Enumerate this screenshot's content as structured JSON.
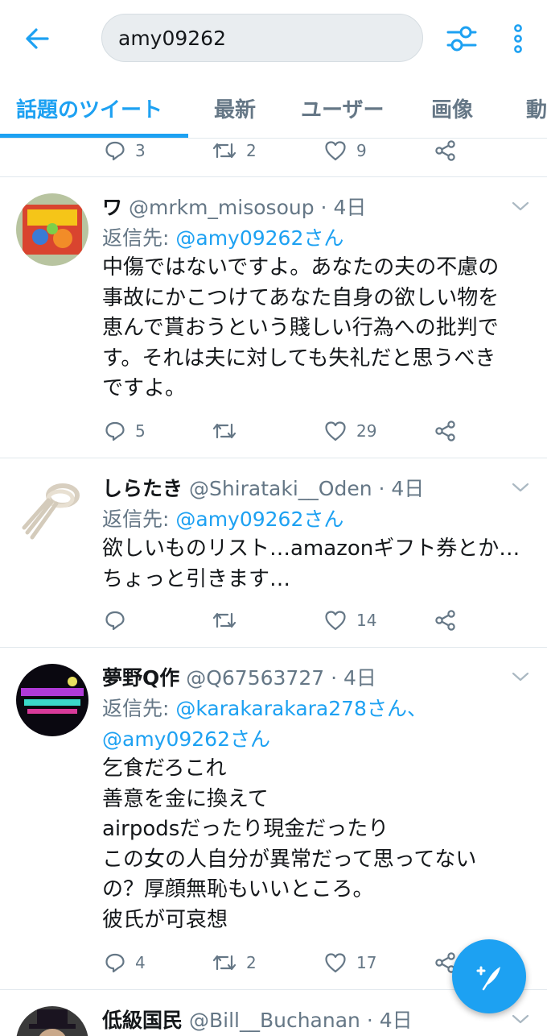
{
  "search": {
    "query": "amy09262"
  },
  "tabs": [
    {
      "label": "話題のツイート"
    },
    {
      "label": "最新"
    },
    {
      "label": "ユーザー"
    },
    {
      "label": "画像"
    },
    {
      "label": "動"
    }
  ],
  "colors": {
    "accent": "#1da1f2",
    "secondary_text": "#657786",
    "divider": "#e1e8ed"
  },
  "tweets": [
    {
      "actions": {
        "replies": "3",
        "retweets": "2",
        "likes": "9"
      }
    },
    {
      "name": "ワ",
      "handle": "@mrkm_misosoup",
      "time": "· 4日",
      "reply_prefix": "返信先: ",
      "reply_to": "@amy09262さん",
      "body_lines": [
        "中傷ではないですよ。あなたの夫の不慮の",
        "事故にかこつけてあなた自身の欲しい物を",
        "恵んで貰おうという賤しい行為への批判で",
        "す。それは夫に対しても失礼だと思うべき",
        "ですよ。"
      ],
      "actions": {
        "replies": "5",
        "retweets": "",
        "likes": "29"
      }
    },
    {
      "name": "しらたき",
      "handle": "@Shirataki__Oden",
      "time": "· 4日",
      "reply_prefix": "返信先: ",
      "reply_to": "@amy09262さん",
      "body_lines": [
        "欲しいものリスト…amazonギフト券とか…",
        "ちょっと引きます…"
      ],
      "actions": {
        "replies": "",
        "retweets": "",
        "likes": "14"
      }
    },
    {
      "name": "夢野Q作",
      "handle": "@Q67563727",
      "time": "· 4日",
      "reply_prefix": "返信先: ",
      "reply_to": "@karakarakara278さん、",
      "reply_to_2": "@amy09262さん",
      "body_lines": [
        "乞食だろこれ",
        "善意を金に換えて",
        "airpodsだったり現金だったり",
        "この女の人自分が異常だって思ってない",
        "の？厚顔無恥もいいところ。",
        "彼氏が可哀想"
      ],
      "actions": {
        "replies": "4",
        "retweets": "2",
        "likes": "17"
      }
    },
    {
      "name": "低級国民",
      "handle": "@Bill__Buchanan",
      "time": "· 4日"
    }
  ]
}
